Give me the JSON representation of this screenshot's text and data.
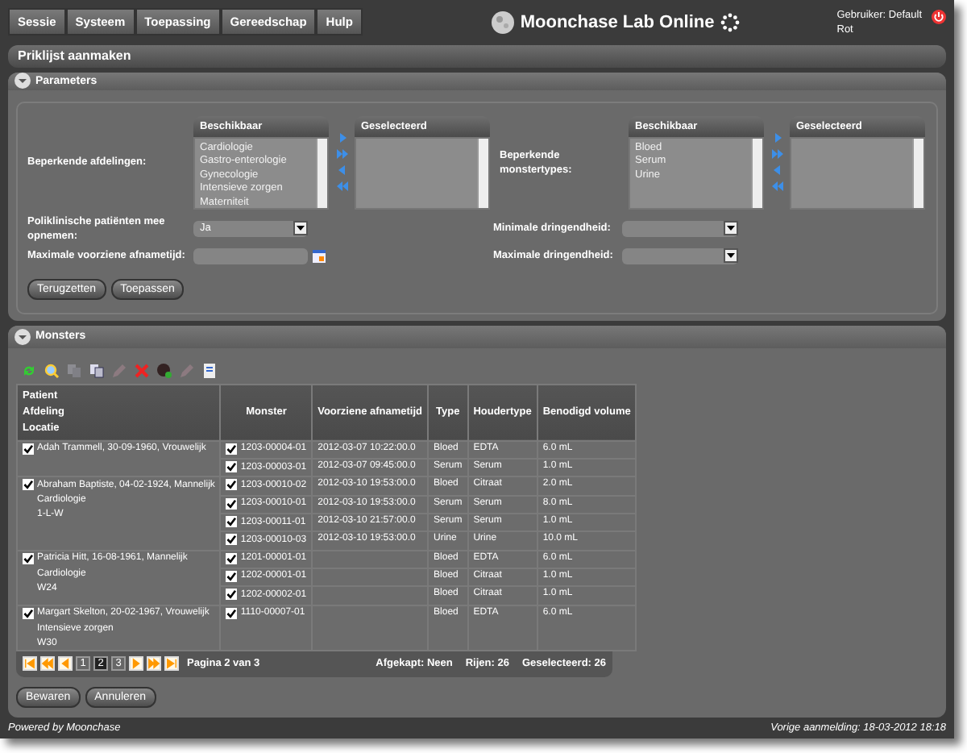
{
  "menu": [
    {
      "label": "Sessie"
    },
    {
      "label": "Systeem"
    },
    {
      "label": "Toepassing"
    },
    {
      "label": "Gereedschap"
    },
    {
      "label": "Hulp"
    }
  ],
  "app_title": "Moonchase Lab Online",
  "user": {
    "label": "Gebruiker: Default",
    "name": "Rot"
  },
  "page_title": "Priklijst aanmaken",
  "parameters": {
    "title": "Parameters",
    "expanded": true,
    "department_filter": {
      "label": "Beperkende afdelingen:",
      "available": {
        "header": "Beschikbaar",
        "items": [
          "Cardiologie",
          "Gastro-enterologie",
          "Gynecologie",
          "Intensieve zorgen",
          "Materniteit"
        ]
      },
      "selected": {
        "header": "Geselecteerd"
      }
    },
    "sample_type_filter": {
      "label": "Beperkende monstertypes:",
      "available": {
        "header": "Beschikbaar",
        "items": [
          "Bloed",
          "Serum",
          "Urine"
        ]
      },
      "selected": {
        "header": "Geselecteerd"
      }
    },
    "outpatients": {
      "label": "Poliklinische patiënten mee opnemen:",
      "value": "Ja"
    },
    "max_collection_time": {
      "label": "Maximale voorziene afnametijd:"
    },
    "min_urgency": {
      "label": "Minimale dringendheid:"
    },
    "max_urgency": {
      "label": "Maximale dringendheid:"
    },
    "buttons": [
      "Terugzetten",
      "Toepassen"
    ]
  },
  "samples": {
    "title": "Monsters",
    "expanded": true,
    "toolbar": [
      {
        "kind": "refresh",
        "disabled": false
      },
      {
        "kind": "search",
        "disabled": false
      },
      {
        "kind": "copy",
        "disabled": true
      },
      {
        "kind": "duplicate",
        "disabled": false
      },
      {
        "kind": "edit",
        "disabled": true
      },
      {
        "kind": "delete",
        "disabled": false
      },
      {
        "kind": "circle",
        "disabled": false
      },
      {
        "kind": "edit",
        "disabled": true
      },
      {
        "kind": "document",
        "disabled": false
      }
    ],
    "columns": [
      {
        "lines": [
          "Patient",
          "Afdeling",
          "Locatie"
        ]
      },
      {
        "lines": [
          "Monster"
        ]
      },
      {
        "lines": [
          "Voorziene afnametijd"
        ]
      },
      {
        "lines": [
          "Type"
        ]
      },
      {
        "lines": [
          "Houdertype"
        ]
      },
      {
        "lines": [
          "Benodigd volume"
        ]
      }
    ],
    "groups": [
      {
        "patient": "Adah Trammell, 30-09-1960, Vrouwelijk",
        "checked": true,
        "samples": [
          {
            "id": "1203-00004-01",
            "checked": true,
            "time": "2012-03-07 10:22:00.0",
            "type": "Bloed",
            "container": "EDTA",
            "volume": "6.0 mL"
          },
          {
            "id": "1203-00003-01",
            "checked": true,
            "time": "2012-03-07 09:45:00.0",
            "type": "Serum",
            "container": "Serum",
            "volume": "1.0 mL"
          }
        ]
      },
      {
        "patient": "Abraham Baptiste, 04-02-1924, Mannelijk",
        "department": "Cardiologie",
        "location": "1-L-W",
        "checked": true,
        "samples": [
          {
            "id": "1203-00010-02",
            "checked": true,
            "time": "2012-03-10 19:53:00.0",
            "type": "Bloed",
            "container": "Citraat",
            "volume": "2.0 mL"
          },
          {
            "id": "1203-00010-01",
            "checked": true,
            "time": "2012-03-10 19:53:00.0",
            "type": "Serum",
            "container": "Serum",
            "volume": "8.0 mL"
          },
          {
            "id": "1203-00011-01",
            "checked": true,
            "time": "2012-03-10 21:57:00.0",
            "type": "Serum",
            "container": "Serum",
            "volume": "1.0 mL"
          },
          {
            "id": "1203-00010-03",
            "checked": true,
            "time": "2012-03-10 19:53:00.0",
            "type": "Urine",
            "container": "Urine",
            "volume": "10.0 mL"
          }
        ]
      },
      {
        "patient": "Patricia Hitt, 16-08-1961, Mannelijk",
        "department": "Cardiologie",
        "location": "W24",
        "checked": true,
        "samples": [
          {
            "id": "1201-00001-01",
            "checked": true,
            "type": "Bloed",
            "container": "EDTA",
            "volume": "6.0 mL"
          },
          {
            "id": "1202-00001-01",
            "checked": true,
            "type": "Bloed",
            "container": "Citraat",
            "volume": "1.0 mL"
          },
          {
            "id": "1202-00002-01",
            "checked": true,
            "type": "Bloed",
            "container": "Citraat",
            "volume": "1.0 mL"
          }
        ]
      },
      {
        "patient": "Margart Skelton, 20-02-1967, Vrouwelijk",
        "department": "Intensieve zorgen",
        "location": "W30",
        "checked": true,
        "samples": [
          {
            "id": "1110-00007-01",
            "checked": true,
            "type": "Bloed",
            "container": "EDTA",
            "volume": "6.0 mL"
          }
        ]
      }
    ],
    "pager": {
      "nav_before": [
        {
          "kind": "first"
        },
        {
          "kind": "prev_fast"
        },
        {
          "kind": "prev"
        }
      ],
      "pages": [
        {
          "label": "1",
          "selected": false
        },
        {
          "label": "2",
          "selected": true
        },
        {
          "label": "3",
          "selected": false
        }
      ],
      "nav_after": [
        {
          "kind": "next"
        },
        {
          "kind": "next_fast"
        },
        {
          "kind": "last"
        }
      ],
      "page_text": "Pagina 2 van 3"
    },
    "status": [
      "Afgekapt: Neen",
      "Rijen: 26",
      "Geselecteerd: 26"
    ],
    "buttons": [
      "Bewaren",
      "Annuleren"
    ]
  },
  "footer": {
    "powered_by": "Powered by",
    "link": "Moonchase",
    "last_login": "Vorige aanmelding: 18-03-2012 18:18"
  }
}
